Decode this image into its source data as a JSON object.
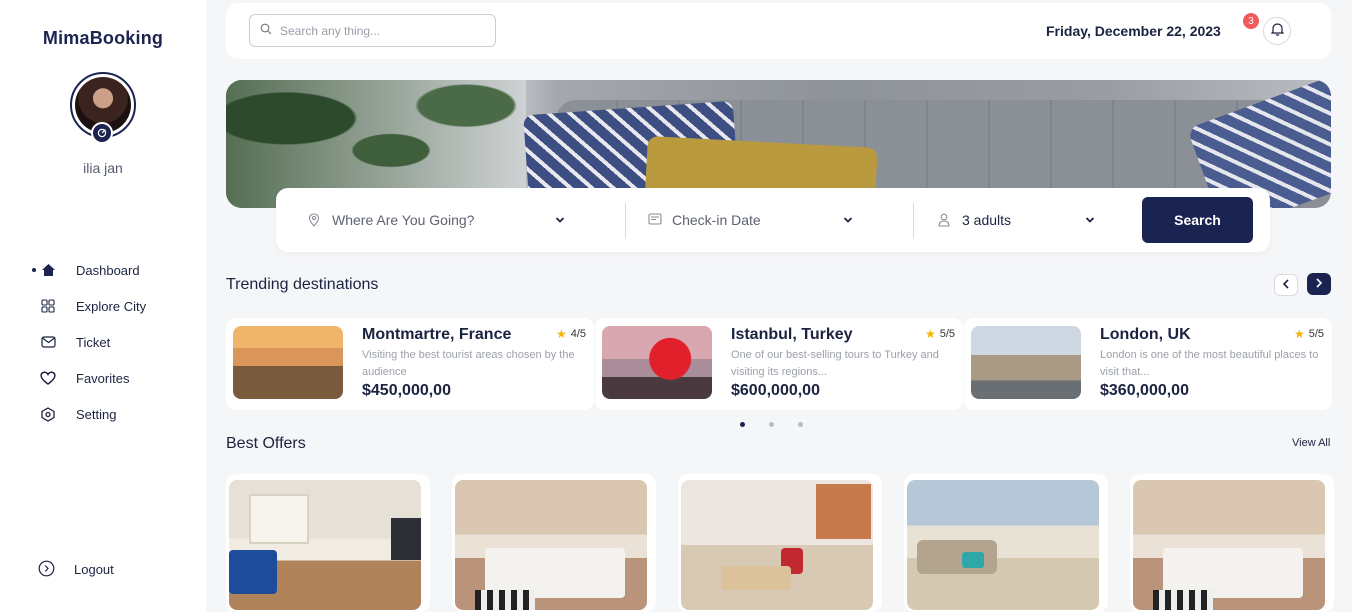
{
  "brand": "MimaBooking",
  "user": {
    "name": "ilia jan"
  },
  "nav": [
    {
      "label": "Dashboard",
      "icon": "home-icon",
      "active": true
    },
    {
      "label": "Explore City",
      "icon": "grid-icon"
    },
    {
      "label": "Ticket",
      "icon": "envelope-icon"
    },
    {
      "label": "Favorites",
      "icon": "heart-icon"
    },
    {
      "label": "Setting",
      "icon": "settings-icon"
    }
  ],
  "logout_label": "Logout",
  "topbar": {
    "search_placeholder": "Search any thing...",
    "date": "Friday, December 22, 2023",
    "notification_count": "3"
  },
  "booking": {
    "destination": "Where Are You Going?",
    "checkin": "Check-in Date",
    "guests": "3 adults",
    "search_label": "Search"
  },
  "trending": {
    "title": "Trending destinations",
    "cards": [
      {
        "name": "Montmartre, France",
        "rating": "4/5",
        "desc": "Visiting the best tourist areas chosen by the audience",
        "price": "$450,000,00"
      },
      {
        "name": "Istanbul, Turkey",
        "rating": "5/5",
        "desc": "One of our best-selling tours to Turkey and visiting its regions...",
        "price": "$600,000,00"
      },
      {
        "name": "London, UK",
        "rating": "5/5",
        "desc": "London is one of the most beautiful places to visit that...",
        "price": "$360,000,00"
      }
    ]
  },
  "offers": {
    "title": "Best Offers",
    "view_all": "View All"
  },
  "colors": {
    "primary": "#1b2450",
    "badge": "#f05a5a",
    "star": "#f5b400"
  }
}
